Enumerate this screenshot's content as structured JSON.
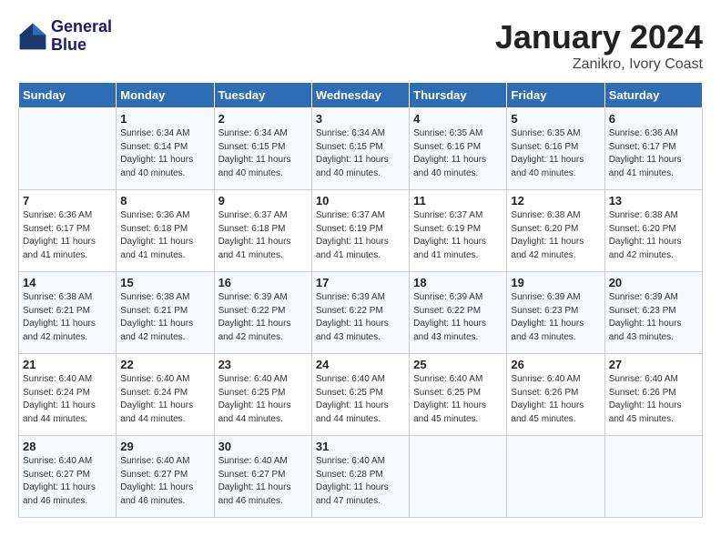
{
  "header": {
    "logo_line1": "General",
    "logo_line2": "Blue",
    "month": "January 2024",
    "location": "Zanikro, Ivory Coast"
  },
  "weekdays": [
    "Sunday",
    "Monday",
    "Tuesday",
    "Wednesday",
    "Thursday",
    "Friday",
    "Saturday"
  ],
  "weeks": [
    [
      {
        "day": "",
        "info": ""
      },
      {
        "day": "1",
        "info": "Sunrise: 6:34 AM\nSunset: 6:14 PM\nDaylight: 11 hours\nand 40 minutes."
      },
      {
        "day": "2",
        "info": "Sunrise: 6:34 AM\nSunset: 6:15 PM\nDaylight: 11 hours\nand 40 minutes."
      },
      {
        "day": "3",
        "info": "Sunrise: 6:34 AM\nSunset: 6:15 PM\nDaylight: 11 hours\nand 40 minutes."
      },
      {
        "day": "4",
        "info": "Sunrise: 6:35 AM\nSunset: 6:16 PM\nDaylight: 11 hours\nand 40 minutes."
      },
      {
        "day": "5",
        "info": "Sunrise: 6:35 AM\nSunset: 6:16 PM\nDaylight: 11 hours\nand 40 minutes."
      },
      {
        "day": "6",
        "info": "Sunrise: 6:36 AM\nSunset: 6:17 PM\nDaylight: 11 hours\nand 41 minutes."
      }
    ],
    [
      {
        "day": "7",
        "info": "Sunrise: 6:36 AM\nSunset: 6:17 PM\nDaylight: 11 hours\nand 41 minutes."
      },
      {
        "day": "8",
        "info": "Sunrise: 6:36 AM\nSunset: 6:18 PM\nDaylight: 11 hours\nand 41 minutes."
      },
      {
        "day": "9",
        "info": "Sunrise: 6:37 AM\nSunset: 6:18 PM\nDaylight: 11 hours\nand 41 minutes."
      },
      {
        "day": "10",
        "info": "Sunrise: 6:37 AM\nSunset: 6:19 PM\nDaylight: 11 hours\nand 41 minutes."
      },
      {
        "day": "11",
        "info": "Sunrise: 6:37 AM\nSunset: 6:19 PM\nDaylight: 11 hours\nand 41 minutes."
      },
      {
        "day": "12",
        "info": "Sunrise: 6:38 AM\nSunset: 6:20 PM\nDaylight: 11 hours\nand 42 minutes."
      },
      {
        "day": "13",
        "info": "Sunrise: 6:38 AM\nSunset: 6:20 PM\nDaylight: 11 hours\nand 42 minutes."
      }
    ],
    [
      {
        "day": "14",
        "info": "Sunrise: 6:38 AM\nSunset: 6:21 PM\nDaylight: 11 hours\nand 42 minutes."
      },
      {
        "day": "15",
        "info": "Sunrise: 6:38 AM\nSunset: 6:21 PM\nDaylight: 11 hours\nand 42 minutes."
      },
      {
        "day": "16",
        "info": "Sunrise: 6:39 AM\nSunset: 6:22 PM\nDaylight: 11 hours\nand 42 minutes."
      },
      {
        "day": "17",
        "info": "Sunrise: 6:39 AM\nSunset: 6:22 PM\nDaylight: 11 hours\nand 43 minutes."
      },
      {
        "day": "18",
        "info": "Sunrise: 6:39 AM\nSunset: 6:22 PM\nDaylight: 11 hours\nand 43 minutes."
      },
      {
        "day": "19",
        "info": "Sunrise: 6:39 AM\nSunset: 6:23 PM\nDaylight: 11 hours\nand 43 minutes."
      },
      {
        "day": "20",
        "info": "Sunrise: 6:39 AM\nSunset: 6:23 PM\nDaylight: 11 hours\nand 43 minutes."
      }
    ],
    [
      {
        "day": "21",
        "info": "Sunrise: 6:40 AM\nSunset: 6:24 PM\nDaylight: 11 hours\nand 44 minutes."
      },
      {
        "day": "22",
        "info": "Sunrise: 6:40 AM\nSunset: 6:24 PM\nDaylight: 11 hours\nand 44 minutes."
      },
      {
        "day": "23",
        "info": "Sunrise: 6:40 AM\nSunset: 6:25 PM\nDaylight: 11 hours\nand 44 minutes."
      },
      {
        "day": "24",
        "info": "Sunrise: 6:40 AM\nSunset: 6:25 PM\nDaylight: 11 hours\nand 44 minutes."
      },
      {
        "day": "25",
        "info": "Sunrise: 6:40 AM\nSunset: 6:25 PM\nDaylight: 11 hours\nand 45 minutes."
      },
      {
        "day": "26",
        "info": "Sunrise: 6:40 AM\nSunset: 6:26 PM\nDaylight: 11 hours\nand 45 minutes."
      },
      {
        "day": "27",
        "info": "Sunrise: 6:40 AM\nSunset: 6:26 PM\nDaylight: 11 hours\nand 45 minutes."
      }
    ],
    [
      {
        "day": "28",
        "info": "Sunrise: 6:40 AM\nSunset: 6:27 PM\nDaylight: 11 hours\nand 46 minutes."
      },
      {
        "day": "29",
        "info": "Sunrise: 6:40 AM\nSunset: 6:27 PM\nDaylight: 11 hours\nand 46 minutes."
      },
      {
        "day": "30",
        "info": "Sunrise: 6:40 AM\nSunset: 6:27 PM\nDaylight: 11 hours\nand 46 minutes."
      },
      {
        "day": "31",
        "info": "Sunrise: 6:40 AM\nSunset: 6:28 PM\nDaylight: 11 hours\nand 47 minutes."
      },
      {
        "day": "",
        "info": ""
      },
      {
        "day": "",
        "info": ""
      },
      {
        "day": "",
        "info": ""
      }
    ]
  ]
}
